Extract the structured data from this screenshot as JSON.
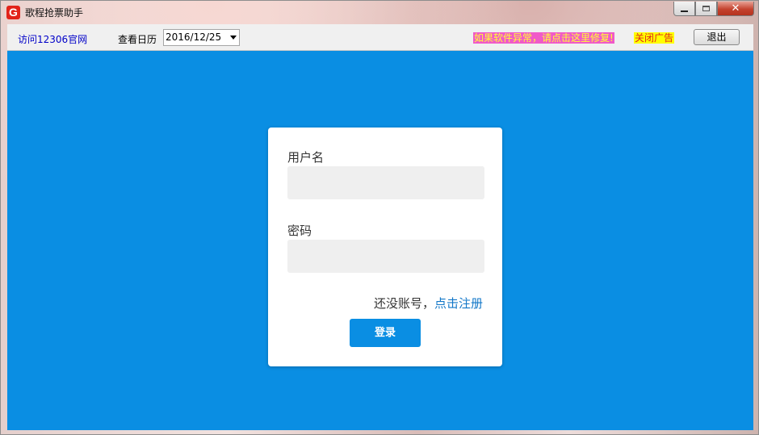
{
  "window": {
    "title": "歌程抢票助手",
    "app_icon_letter": "G",
    "controls": {
      "minimize": "",
      "maximize": "",
      "close": "✕"
    }
  },
  "toolbar": {
    "visit_link": "访问12306官网",
    "calendar_label": "查看日历",
    "calendar_value": "2016/12/25",
    "repair_link": "如果软件异常，请点击这里修复!",
    "close_ad": "关闭广告",
    "exit_button": "退出"
  },
  "login": {
    "username_label": "用户名",
    "username_value": "",
    "password_label": "密码",
    "password_value": "",
    "no_account_text": "还没账号，",
    "register_link": "点击注册",
    "login_button": "登录"
  },
  "colors": {
    "main_bg": "#0a8ee3",
    "repair_bg": "#f05ac8",
    "repair_text": "#ffff33",
    "ad_bg": "#ffff00",
    "ad_text": "#e0241c",
    "link": "#1277c8"
  }
}
